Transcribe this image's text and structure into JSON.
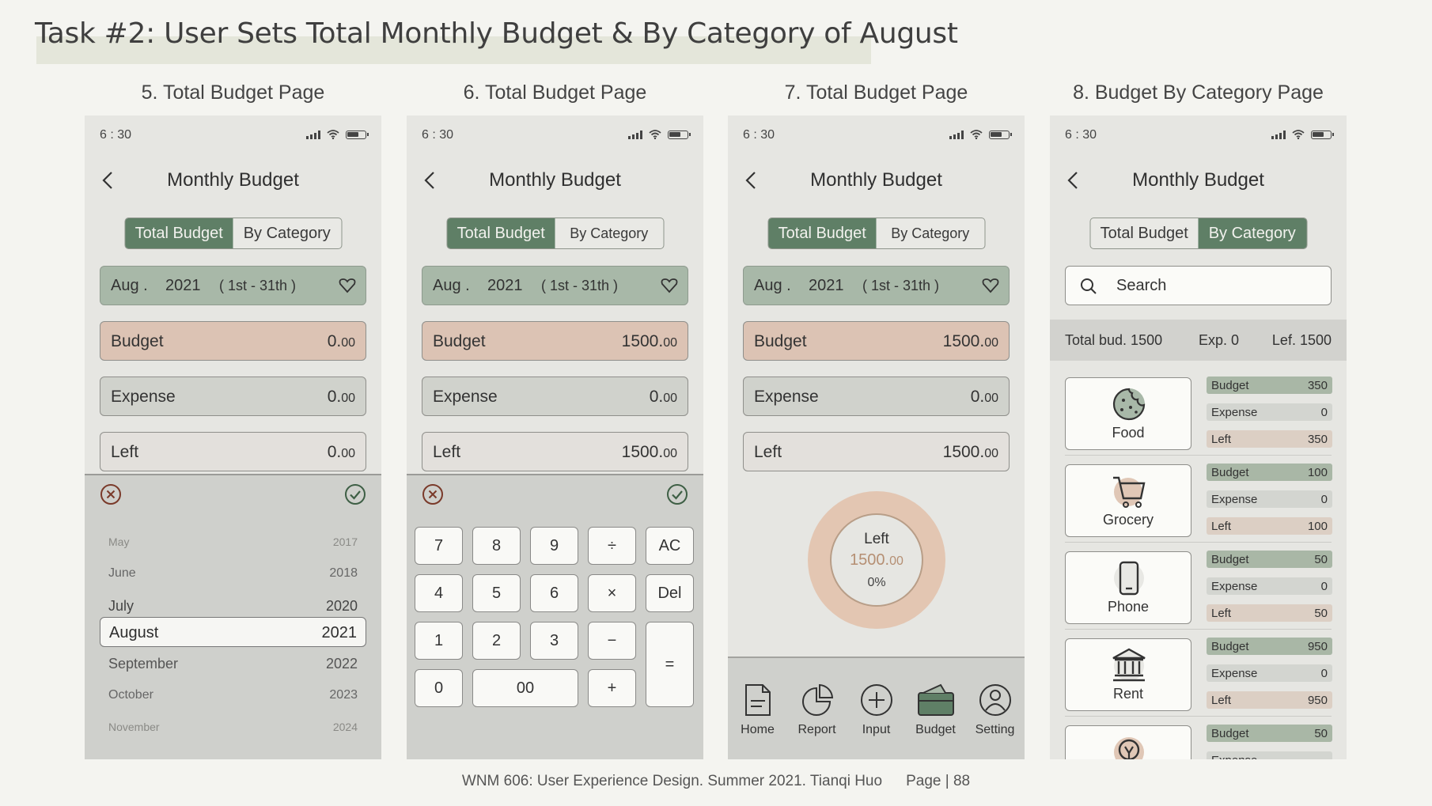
{
  "heading": {
    "prefix": "Task #2:",
    "text": "User Sets Total Monthly Budget & By Category of August"
  },
  "screens": [
    {
      "label": "5. Total Budget Page"
    },
    {
      "label": "6. Total Budget Page"
    },
    {
      "label": "7. Total Budget Page"
    },
    {
      "label": "8. Budget By Category Page"
    }
  ],
  "status": {
    "time": "6 : 30"
  },
  "nav": {
    "title": "Monthly Budget"
  },
  "segment": {
    "total": "Total Budget",
    "category": "By Category"
  },
  "month_selector": {
    "month": "Aug .",
    "year": "2021",
    "range": "( 1st - 31th )"
  },
  "rows": {
    "budget": "Budget",
    "expense": "Expense",
    "left": "Left"
  },
  "screen5": {
    "budget_int": "0.",
    "budget_dec": "00",
    "expense_int": "0.",
    "expense_dec": "00",
    "left_int": "0.",
    "left_dec": "00",
    "picker": [
      {
        "month": "May",
        "year": "2017"
      },
      {
        "month": "June",
        "year": "2018"
      },
      {
        "month": "July",
        "year": "2020"
      },
      {
        "month": "August",
        "year": "2021"
      },
      {
        "month": "September",
        "year": "2022"
      },
      {
        "month": "October",
        "year": "2023"
      },
      {
        "month": "November",
        "year": "2024"
      }
    ]
  },
  "screen6": {
    "budget_int": "1500.",
    "budget_dec": "00",
    "expense_int": "0.",
    "expense_dec": "00",
    "left_int": "1500.",
    "left_dec": "00",
    "keys": [
      "7",
      "8",
      "9",
      "÷",
      "AC",
      "4",
      "5",
      "6",
      "×",
      "Del",
      "1",
      "2",
      "3",
      "−",
      "=",
      "0",
      "00",
      "+"
    ]
  },
  "screen7": {
    "budget_int": "1500.",
    "budget_dec": "00",
    "expense_int": "0.",
    "expense_dec": "00",
    "left_int": "1500.",
    "left_dec": "00",
    "donut": {
      "label": "Left",
      "value_int": "1500.",
      "value_dec": "00",
      "percent": "0%"
    },
    "tabs": [
      "Home",
      "Report",
      "Input",
      "Budget",
      "Setting"
    ]
  },
  "screen8": {
    "search_placeholder": "Search",
    "totals": {
      "total": "Total bud. 1500",
      "expense": "Exp. 0",
      "left": "Lef. 1500"
    },
    "mini_labels": {
      "budget": "Budget",
      "expense": "Expense",
      "left": "Left"
    },
    "categories": [
      {
        "name": "Food",
        "icon": "cookie-icon",
        "budget": "350",
        "expense": "0",
        "left": "350"
      },
      {
        "name": "Grocery",
        "icon": "cart-icon",
        "budget": "100",
        "expense": "0",
        "left": "100"
      },
      {
        "name": "Phone",
        "icon": "phone-icon",
        "budget": "50",
        "expense": "0",
        "left": "50"
      },
      {
        "name": "Rent",
        "icon": "bank-icon",
        "budget": "950",
        "expense": "0",
        "left": "950"
      },
      {
        "name": "",
        "icon": "bulb-icon",
        "budget": "50",
        "expense": "",
        "left": ""
      }
    ]
  },
  "footer": {
    "text": "WNM 606: User Experience Design. Summer 2021. Tianqi Huo",
    "page": "Page | 88"
  },
  "colors": {
    "green": "#5f7f66",
    "budget_row": "#dcc3b4",
    "month_bar": "#a8b8a8",
    "donut": "#e3c6b2"
  }
}
